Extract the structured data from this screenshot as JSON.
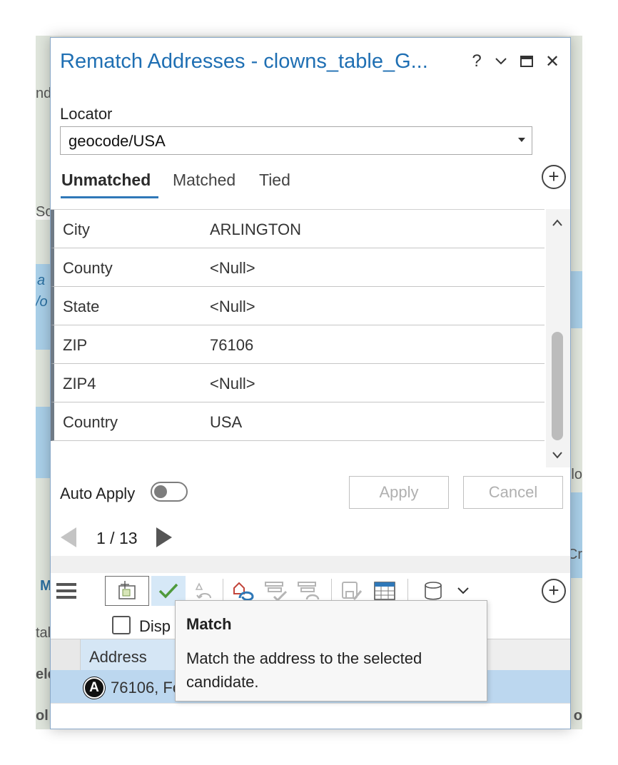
{
  "pane": {
    "title": "Rematch Addresses - clowns_table_G...",
    "help_glyph": "?",
    "menu_glyph": "⌄",
    "close_glyph": "✕"
  },
  "locator": {
    "label": "Locator",
    "value": "geocode/USA"
  },
  "tabs": [
    {
      "label": "Unmatched",
      "active": true
    },
    {
      "label": "Matched",
      "active": false
    },
    {
      "label": "Tied",
      "active": false
    }
  ],
  "fields": [
    {
      "name": "City",
      "value": "ARLINGTON"
    },
    {
      "name": "County",
      "value": "<Null>"
    },
    {
      "name": "State",
      "value": "<Null>"
    },
    {
      "name": "ZIP",
      "value": "76106"
    },
    {
      "name": "ZIP4",
      "value": "<Null>"
    },
    {
      "name": "Country",
      "value": "USA"
    }
  ],
  "auto_apply": {
    "label": "Auto Apply",
    "on": false
  },
  "buttons": {
    "apply": "Apply",
    "cancel": "Cancel"
  },
  "pager": {
    "text": "1 / 13"
  },
  "toolbar": {
    "icons": [
      "menu-icon",
      "zoom-to-candidate-icon",
      "match-icon",
      "unmatch-icon",
      "add-candidate-icon",
      "filter-icon",
      "filter-rematch-icon",
      "save-edit-icon",
      "table-icon",
      "database-icon",
      "dropdown-chevron-icon",
      "add-icon"
    ],
    "plus_glyph": "+",
    "chevron_glyph": "⌄"
  },
  "display_checkbox": {
    "label": "Disp",
    "checked": false
  },
  "candidates_table": {
    "columns": [
      "Address"
    ],
    "rows": [
      {
        "badge": "A",
        "address": "76106, Fo"
      }
    ]
  },
  "tooltip": {
    "title": "Match",
    "body": "Match the address to the selected candidate."
  },
  "map_labels": {
    "left": [
      "nd",
      "Sc",
      "a",
      "/o",
      "M",
      "tal",
      "ele",
      "ol"
    ],
    "right": [
      "lo",
      "Cr",
      "o"
    ]
  },
  "colors": {
    "title_blue": "#1f6fb3",
    "tab_underline": "#2f78b8",
    "selection": "#bcd7ef"
  }
}
